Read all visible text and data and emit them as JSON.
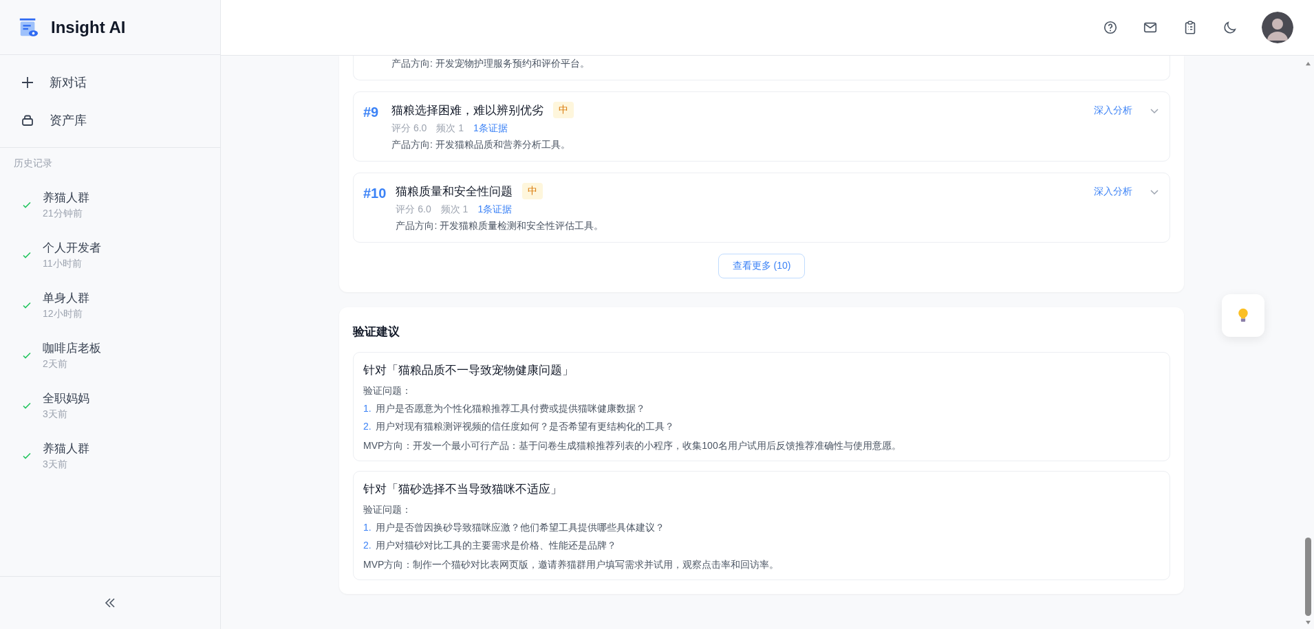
{
  "app": {
    "name": "Insight AI"
  },
  "sidebar": {
    "actions": [
      {
        "label": "新对话",
        "kind": "new"
      },
      {
        "label": "资产库",
        "kind": "library"
      }
    ],
    "history_title": "历史记录",
    "history": [
      {
        "title": "养猫人群",
        "time": "21分钟前",
        "done": true
      },
      {
        "title": "个人开发者",
        "time": "11小时前",
        "done": true
      },
      {
        "title": "单身人群",
        "time": "12小时前",
        "done": true
      },
      {
        "title": "咖啡店老板",
        "time": "2天前",
        "done": true
      },
      {
        "title": "全职妈妈",
        "time": "3天前",
        "done": true
      },
      {
        "title": "养猫人群",
        "time": "3天前",
        "done": true
      }
    ]
  },
  "problems": {
    "partial_direction": "产品方向: 开发宠物护理服务预约和评价平台。",
    "items": [
      {
        "rank": "#9",
        "title": "猫粮选择困难，难以辨别优劣",
        "priority": "中",
        "score": "评分 6.0",
        "frequency": "频次 1",
        "evidence": "1条证据",
        "direction": "产品方向: 开发猫粮品质和营养分析工具。",
        "action": "深入分析",
        "expanded": false
      },
      {
        "rank": "#10",
        "title": "猫粮质量和安全性问题",
        "priority": "中",
        "score": "评分 6.0",
        "frequency": "频次 1",
        "evidence": "1条证据",
        "direction": "产品方向: 开发猫粮质量检测和安全性评估工具。",
        "action": "深入分析",
        "expanded": false
      }
    ],
    "more_button": "查看更多 (10)"
  },
  "validation": {
    "title": "验证建议",
    "items": [
      {
        "target": "针对「猫粮品质不一导致宠物健康问题」",
        "questions_label": "验证问题：",
        "questions": [
          {
            "index": "1.",
            "text": "用户是否愿意为个性化猫粮推荐工具付费或提供猫咪健康数据？"
          },
          {
            "index": "2.",
            "text": "用户对现有猫粮测评视频的信任度如何？是否希望有更结构化的工具？"
          }
        ],
        "mvp": "MVP方向：开发一个最小可行产品：基于问卷生成猫粮推荐列表的小程序，收集100名用户试用后反馈推荐准确性与使用意愿。"
      },
      {
        "target": "针对「猫砂选择不当导致猫咪不适应」",
        "questions_label": "验证问题：",
        "questions": [
          {
            "index": "1.",
            "text": "用户是否曾因换砂导致猫咪应激？他们希望工具提供哪些具体建议？"
          },
          {
            "index": "2.",
            "text": "用户对猫砂对比工具的主要需求是价格、性能还是品牌？"
          }
        ],
        "mvp": "MVP方向：制作一个猫砂对比表网页版，邀请养猫群用户填写需求并试用，观察点击率和回访率。"
      }
    ]
  }
}
